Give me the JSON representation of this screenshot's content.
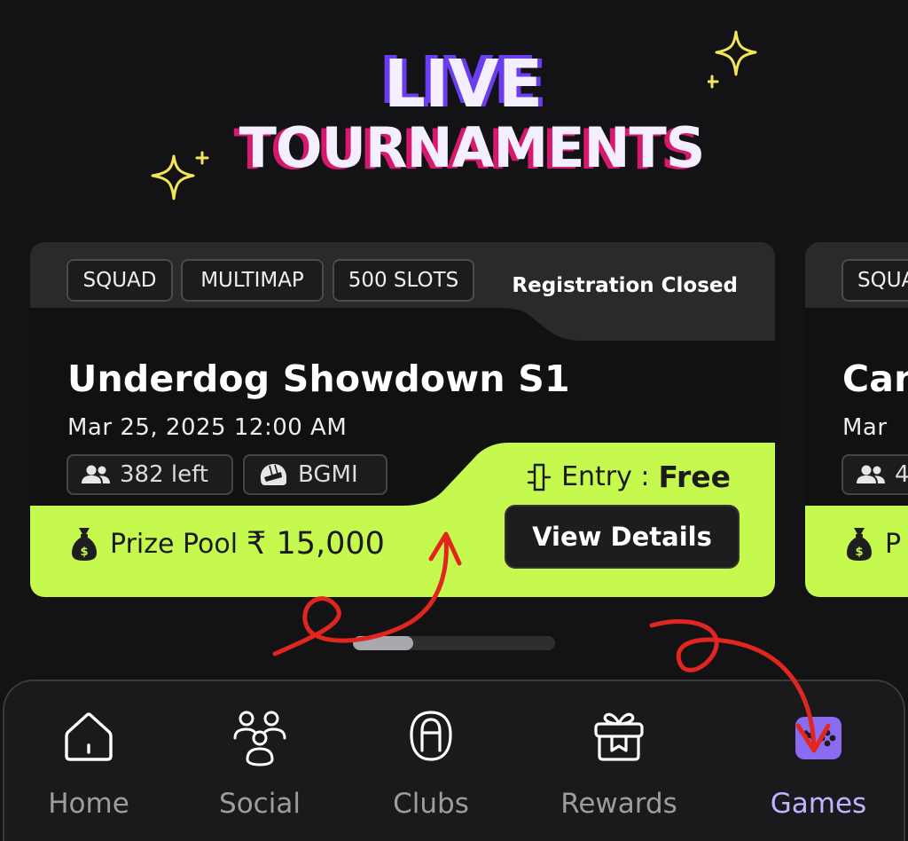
{
  "header": {
    "title_line1": "LIVE",
    "title_line2": "TOURNAMENTS"
  },
  "tournament_card": {
    "tags": [
      "SQUAD",
      "MULTIMAP",
      "500 SLOTS"
    ],
    "status": "Registration Closed",
    "name": "Underdog Showdown S1",
    "datetime": "Mar 25, 2025 12:00 AM",
    "slots_left": "382 left",
    "game": "BGMI",
    "entry_label": "Entry :",
    "entry_value": "Free",
    "cta_label": "View Details",
    "prize_label": "Prize Pool",
    "prize_amount": "₹ 15,000"
  },
  "peek_card": {
    "tag": "SQUA",
    "name": "Can",
    "date": "Mar",
    "slots": "4",
    "prize_label": "P"
  },
  "carousel": {
    "position": 0.0,
    "visible_fraction": 0.3
  },
  "bottom_nav": {
    "items": [
      {
        "label": "Home",
        "icon": "home-icon",
        "active": false
      },
      {
        "label": "Social",
        "icon": "social-icon",
        "active": false
      },
      {
        "label": "Clubs",
        "icon": "clubs-icon",
        "active": false
      },
      {
        "label": "Rewards",
        "icon": "rewards-icon",
        "active": false
      },
      {
        "label": "Games",
        "icon": "games-icon",
        "active": true
      }
    ]
  },
  "colors": {
    "background": "#131315",
    "accent_lime": "#c6f94d",
    "accent_purple": "#8a6cf2",
    "title_shadow_purple": "#6b3cf0",
    "title_shadow_pink": "#d6186e",
    "annotation_red": "#e0261f",
    "sparkle_yellow": "#f4e45a"
  }
}
